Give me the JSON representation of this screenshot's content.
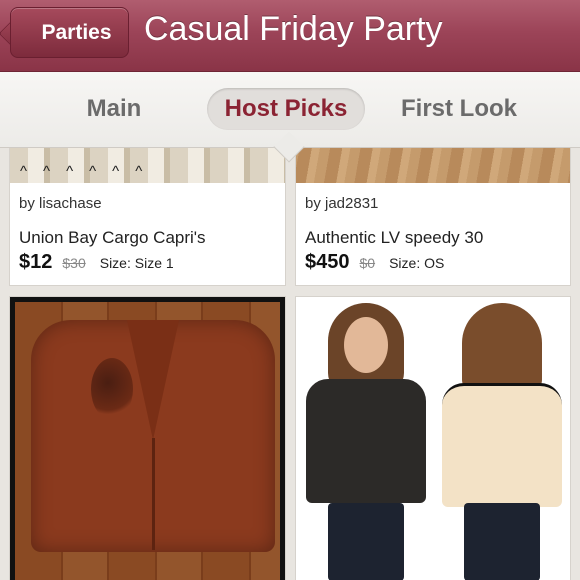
{
  "header": {
    "back_label": "Parties",
    "title": "Casual Friday Party"
  },
  "tabs": [
    {
      "label": "Main"
    },
    {
      "label": "Host Picks"
    },
    {
      "label": "First Look"
    }
  ],
  "listings": [
    {
      "seller": "by lisachase",
      "name": "Union Bay Cargo Capri's",
      "price": "$12",
      "original_price": "$30",
      "size": "Size: Size 1"
    },
    {
      "seller": "by jad2831",
      "name": "Authentic LV speedy 30",
      "price": "$450",
      "original_price": "$0",
      "size": "Size: OS"
    }
  ],
  "colors": {
    "header_bg": "#9c4458",
    "active_tab_text": "#8b2333",
    "tab_text": "#6b6b6b"
  }
}
